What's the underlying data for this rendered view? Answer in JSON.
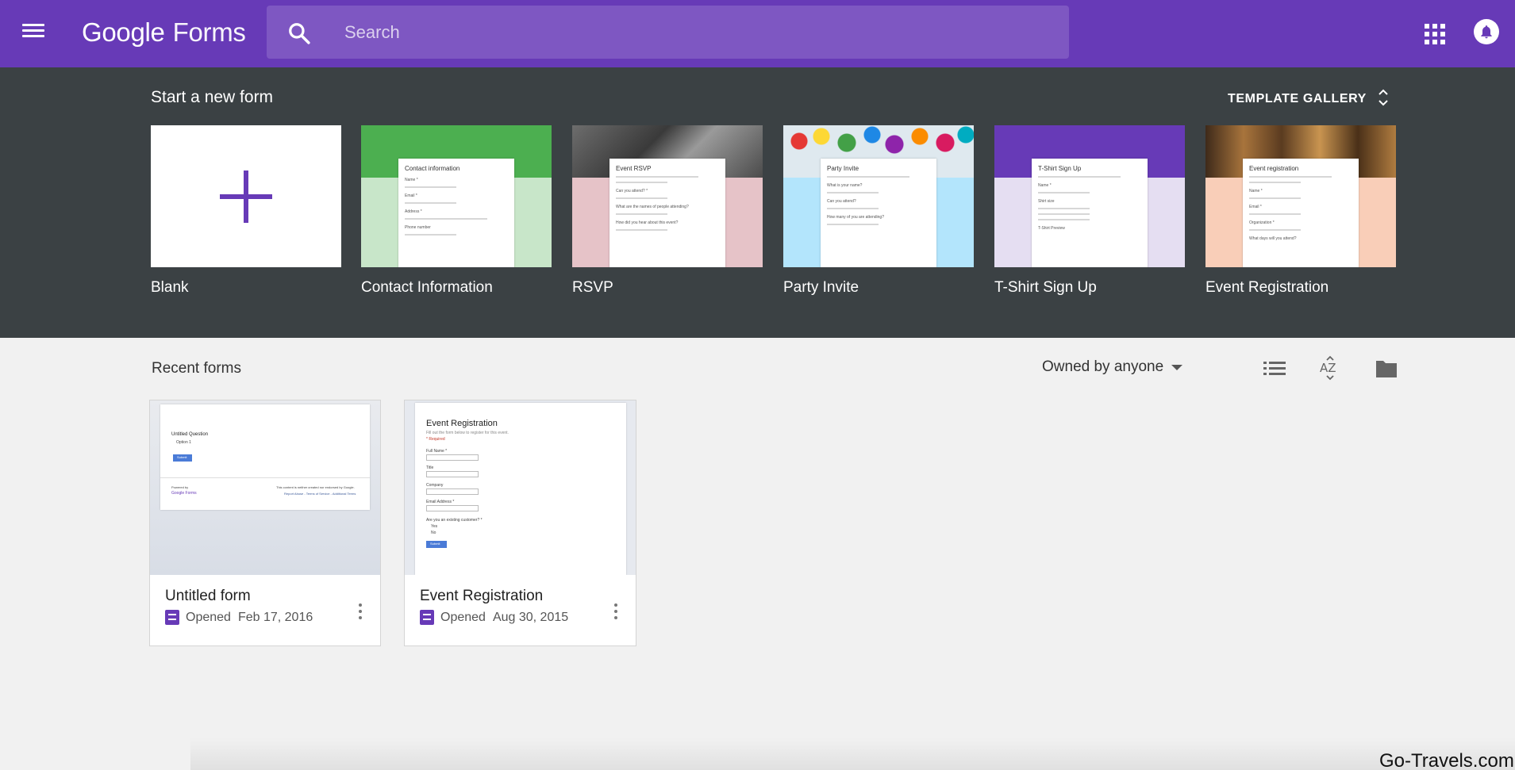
{
  "app": {
    "logo_google": "Google",
    "logo_product": "Forms"
  },
  "search": {
    "placeholder": "Search"
  },
  "icons": {
    "menu": "hamburger-icon",
    "search": "search-icon",
    "apps": "apps-grid-icon",
    "notifications": "notifications-icon",
    "list_view": "list-view-icon",
    "sort": "sort-az-icon",
    "folder": "folder-icon",
    "more": "more-vert-icon",
    "form_file": "forms-file-icon",
    "plus": "plus-icon"
  },
  "colors": {
    "brand": "#673ab7",
    "search_bg": "#7e57c2",
    "template_bg": "#3b4144",
    "page_bg": "#f1f1f1"
  },
  "templates": {
    "title": "Start a new form",
    "gallery_label": "TEMPLATE GALLERY",
    "items": [
      {
        "label": "Blank"
      },
      {
        "label": "Contact Information",
        "sheet_title": "Contact information",
        "fields": [
          "Name *",
          "Email *",
          "Address *",
          "Phone number"
        ]
      },
      {
        "label": "RSVP",
        "sheet_title": "Event RSVP",
        "fields": [
          "Can you attend? *",
          "What are the names of people attending?",
          "How did you hear about this event?"
        ]
      },
      {
        "label": "Party Invite",
        "sheet_title": "Party Invite",
        "fields": [
          "What is your name?",
          "Can you attend?",
          "How many of you are attending?"
        ]
      },
      {
        "label": "T-Shirt Sign Up",
        "sheet_title": "T-Shirt Sign Up",
        "fields": [
          "Name *",
          "Shirt size",
          "T-Shirt Preview"
        ]
      },
      {
        "label": "Event Registration",
        "sheet_title": "Event registration",
        "fields": [
          "Name *",
          "Email *",
          "Organization *",
          "What days will you attend?"
        ]
      }
    ]
  },
  "recent": {
    "title": "Recent forms",
    "owner_filter": "Owned by anyone",
    "forms": [
      {
        "title": "Untitled form",
        "opened_label": "Opened",
        "date": "Feb 17, 2016",
        "preview": {
          "question": "Untitled Question",
          "option": "Option 1",
          "submit": "Submit",
          "powered_by": "Powered by",
          "brand": "Google Forms",
          "disclaimer": "This content is neither created nor endorsed by Google.",
          "links": "Report Abuse - Terms of Service - Additional Terms"
        }
      },
      {
        "title": "Event Registration",
        "opened_label": "Opened",
        "date": "Aug 30, 2015",
        "preview": {
          "heading": "Event Registration",
          "subheading": "Fill out the form below to register for this event.",
          "required": "* Required",
          "fields": [
            "Full Name *",
            "Title",
            "Company",
            "Email Address *",
            "Are you an existing customer? *"
          ],
          "options": [
            "Yes",
            "No"
          ],
          "submit": "Submit"
        }
      }
    ]
  },
  "watermark": "Go-Travels.com"
}
